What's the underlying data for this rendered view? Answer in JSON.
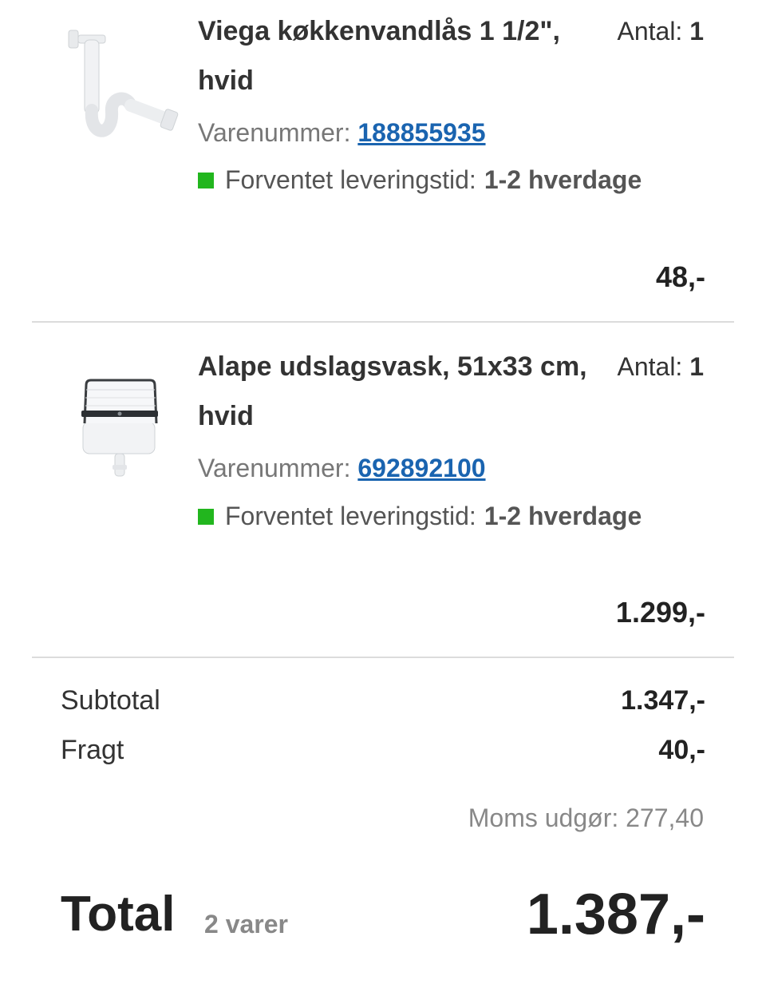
{
  "cart": {
    "items": [
      {
        "name": "Viega køkkenvandlås 1 1/2\", hvid",
        "qty_label": "Antal:",
        "qty": "1",
        "sku_label": "Varenummer:",
        "sku": "188855935",
        "delivery_label": "Forventet leveringstid:",
        "delivery_value": "1-2 hverdage",
        "price": "48,-",
        "icon": "drain-trap-product-image"
      },
      {
        "name": "Alape udslagsvask, 51x33 cm, hvid",
        "qty_label": "Antal:",
        "qty": "1",
        "sku_label": "Varenummer:",
        "sku": "692892100",
        "delivery_label": "Forventet leveringstid:",
        "delivery_value": "1-2 hverdage",
        "price": "1.299,-",
        "icon": "utility-sink-product-image"
      }
    ]
  },
  "summary": {
    "subtotal_label": "Subtotal",
    "subtotal_value": "1.347,-",
    "shipping_label": "Fragt",
    "shipping_value": "40,-",
    "vat_text": "Moms udgør: 277,40",
    "total_label": "Total",
    "item_count": "2 varer",
    "total_value": "1.387,-"
  },
  "colors": {
    "link": "#1a64b0",
    "in_stock": "#22b61e",
    "divider": "#dcdcdc"
  }
}
